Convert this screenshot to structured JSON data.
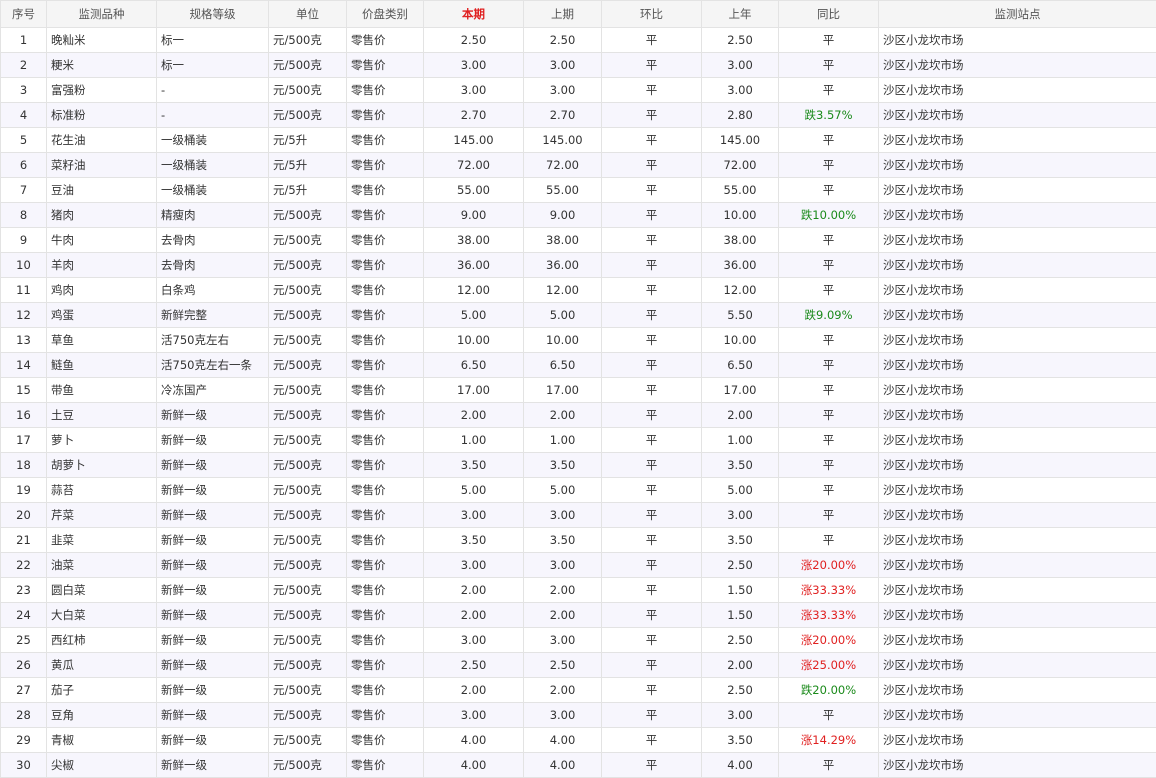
{
  "headers": {
    "seq": "序号",
    "item": "监测品种",
    "spec": "规格等级",
    "unit": "单位",
    "price_type": "价盘类别",
    "current": "本期",
    "previous": "上期",
    "mom": "环比",
    "last_year": "上年",
    "yoy": "同比",
    "station": "监测站点"
  },
  "colors": {
    "highlight": "#e02020",
    "rise": "#e02020",
    "fall": "#1a8a1a",
    "stripe": "#f7f6fd"
  },
  "rows": [
    {
      "seq": "1",
      "item": "晚籼米",
      "spec": "标一",
      "unit": "元/500克",
      "type": "零售价",
      "cur": "2.50",
      "prev": "2.50",
      "mom": "平",
      "ly": "2.50",
      "yoy": "平",
      "yoy_trend": "flat",
      "station": "沙区小龙坎市场"
    },
    {
      "seq": "2",
      "item": "粳米",
      "spec": "标一",
      "unit": "元/500克",
      "type": "零售价",
      "cur": "3.00",
      "prev": "3.00",
      "mom": "平",
      "ly": "3.00",
      "yoy": "平",
      "yoy_trend": "flat",
      "station": "沙区小龙坎市场"
    },
    {
      "seq": "3",
      "item": "富强粉",
      "spec": "-",
      "unit": "元/500克",
      "type": "零售价",
      "cur": "3.00",
      "prev": "3.00",
      "mom": "平",
      "ly": "3.00",
      "yoy": "平",
      "yoy_trend": "flat",
      "station": "沙区小龙坎市场"
    },
    {
      "seq": "4",
      "item": "标准粉",
      "spec": "-",
      "unit": "元/500克",
      "type": "零售价",
      "cur": "2.70",
      "prev": "2.70",
      "mom": "平",
      "ly": "2.80",
      "yoy": "跌3.57%",
      "yoy_trend": "down",
      "station": "沙区小龙坎市场"
    },
    {
      "seq": "5",
      "item": "花生油",
      "spec": "一级桶装",
      "unit": "元/5升",
      "type": "零售价",
      "cur": "145.00",
      "prev": "145.00",
      "mom": "平",
      "ly": "145.00",
      "yoy": "平",
      "yoy_trend": "flat",
      "station": "沙区小龙坎市场"
    },
    {
      "seq": "6",
      "item": "菜籽油",
      "spec": "一级桶装",
      "unit": "元/5升",
      "type": "零售价",
      "cur": "72.00",
      "prev": "72.00",
      "mom": "平",
      "ly": "72.00",
      "yoy": "平",
      "yoy_trend": "flat",
      "station": "沙区小龙坎市场"
    },
    {
      "seq": "7",
      "item": "豆油",
      "spec": "一级桶装",
      "unit": "元/5升",
      "type": "零售价",
      "cur": "55.00",
      "prev": "55.00",
      "mom": "平",
      "ly": "55.00",
      "yoy": "平",
      "yoy_trend": "flat",
      "station": "沙区小龙坎市场"
    },
    {
      "seq": "8",
      "item": "猪肉",
      "spec": "精瘦肉",
      "unit": "元/500克",
      "type": "零售价",
      "cur": "9.00",
      "prev": "9.00",
      "mom": "平",
      "ly": "10.00",
      "yoy": "跌10.00%",
      "yoy_trend": "down",
      "station": "沙区小龙坎市场"
    },
    {
      "seq": "9",
      "item": "牛肉",
      "spec": "去骨肉",
      "unit": "元/500克",
      "type": "零售价",
      "cur": "38.00",
      "prev": "38.00",
      "mom": "平",
      "ly": "38.00",
      "yoy": "平",
      "yoy_trend": "flat",
      "station": "沙区小龙坎市场"
    },
    {
      "seq": "10",
      "item": "羊肉",
      "spec": "去骨肉",
      "unit": "元/500克",
      "type": "零售价",
      "cur": "36.00",
      "prev": "36.00",
      "mom": "平",
      "ly": "36.00",
      "yoy": "平",
      "yoy_trend": "flat",
      "station": "沙区小龙坎市场"
    },
    {
      "seq": "11",
      "item": "鸡肉",
      "spec": "白条鸡",
      "unit": "元/500克",
      "type": "零售价",
      "cur": "12.00",
      "prev": "12.00",
      "mom": "平",
      "ly": "12.00",
      "yoy": "平",
      "yoy_trend": "flat",
      "station": "沙区小龙坎市场"
    },
    {
      "seq": "12",
      "item": "鸡蛋",
      "spec": "新鲜完整",
      "unit": "元/500克",
      "type": "零售价",
      "cur": "5.00",
      "prev": "5.00",
      "mom": "平",
      "ly": "5.50",
      "yoy": "跌9.09%",
      "yoy_trend": "down",
      "station": "沙区小龙坎市场"
    },
    {
      "seq": "13",
      "item": "草鱼",
      "spec": "活750克左右",
      "unit": "元/500克",
      "type": "零售价",
      "cur": "10.00",
      "prev": "10.00",
      "mom": "平",
      "ly": "10.00",
      "yoy": "平",
      "yoy_trend": "flat",
      "station": "沙区小龙坎市场"
    },
    {
      "seq": "14",
      "item": "鲢鱼",
      "spec": "活750克左右一条",
      "unit": "元/500克",
      "type": "零售价",
      "cur": "6.50",
      "prev": "6.50",
      "mom": "平",
      "ly": "6.50",
      "yoy": "平",
      "yoy_trend": "flat",
      "station": "沙区小龙坎市场"
    },
    {
      "seq": "15",
      "item": "带鱼",
      "spec": "冷冻国产",
      "unit": "元/500克",
      "type": "零售价",
      "cur": "17.00",
      "prev": "17.00",
      "mom": "平",
      "ly": "17.00",
      "yoy": "平",
      "yoy_trend": "flat",
      "station": "沙区小龙坎市场"
    },
    {
      "seq": "16",
      "item": "土豆",
      "spec": "新鲜一级",
      "unit": "元/500克",
      "type": "零售价",
      "cur": "2.00",
      "prev": "2.00",
      "mom": "平",
      "ly": "2.00",
      "yoy": "平",
      "yoy_trend": "flat",
      "station": "沙区小龙坎市场"
    },
    {
      "seq": "17",
      "item": "萝卜",
      "spec": "新鲜一级",
      "unit": "元/500克",
      "type": "零售价",
      "cur": "1.00",
      "prev": "1.00",
      "mom": "平",
      "ly": "1.00",
      "yoy": "平",
      "yoy_trend": "flat",
      "station": "沙区小龙坎市场"
    },
    {
      "seq": "18",
      "item": "胡萝卜",
      "spec": "新鲜一级",
      "unit": "元/500克",
      "type": "零售价",
      "cur": "3.50",
      "prev": "3.50",
      "mom": "平",
      "ly": "3.50",
      "yoy": "平",
      "yoy_trend": "flat",
      "station": "沙区小龙坎市场"
    },
    {
      "seq": "19",
      "item": "蒜苔",
      "spec": "新鲜一级",
      "unit": "元/500克",
      "type": "零售价",
      "cur": "5.00",
      "prev": "5.00",
      "mom": "平",
      "ly": "5.00",
      "yoy": "平",
      "yoy_trend": "flat",
      "station": "沙区小龙坎市场"
    },
    {
      "seq": "20",
      "item": "芹菜",
      "spec": "新鲜一级",
      "unit": "元/500克",
      "type": "零售价",
      "cur": "3.00",
      "prev": "3.00",
      "mom": "平",
      "ly": "3.00",
      "yoy": "平",
      "yoy_trend": "flat",
      "station": "沙区小龙坎市场"
    },
    {
      "seq": "21",
      "item": "韭菜",
      "spec": "新鲜一级",
      "unit": "元/500克",
      "type": "零售价",
      "cur": "3.50",
      "prev": "3.50",
      "mom": "平",
      "ly": "3.50",
      "yoy": "平",
      "yoy_trend": "flat",
      "station": "沙区小龙坎市场"
    },
    {
      "seq": "22",
      "item": "油菜",
      "spec": "新鲜一级",
      "unit": "元/500克",
      "type": "零售价",
      "cur": "3.00",
      "prev": "3.00",
      "mom": "平",
      "ly": "2.50",
      "yoy": "涨20.00%",
      "yoy_trend": "up",
      "station": "沙区小龙坎市场"
    },
    {
      "seq": "23",
      "item": "圆白菜",
      "spec": "新鲜一级",
      "unit": "元/500克",
      "type": "零售价",
      "cur": "2.00",
      "prev": "2.00",
      "mom": "平",
      "ly": "1.50",
      "yoy": "涨33.33%",
      "yoy_trend": "up",
      "station": "沙区小龙坎市场"
    },
    {
      "seq": "24",
      "item": "大白菜",
      "spec": "新鲜一级",
      "unit": "元/500克",
      "type": "零售价",
      "cur": "2.00",
      "prev": "2.00",
      "mom": "平",
      "ly": "1.50",
      "yoy": "涨33.33%",
      "yoy_trend": "up",
      "station": "沙区小龙坎市场"
    },
    {
      "seq": "25",
      "item": "西红柿",
      "spec": "新鲜一级",
      "unit": "元/500克",
      "type": "零售价",
      "cur": "3.00",
      "prev": "3.00",
      "mom": "平",
      "ly": "2.50",
      "yoy": "涨20.00%",
      "yoy_trend": "up",
      "station": "沙区小龙坎市场"
    },
    {
      "seq": "26",
      "item": "黄瓜",
      "spec": "新鲜一级",
      "unit": "元/500克",
      "type": "零售价",
      "cur": "2.50",
      "prev": "2.50",
      "mom": "平",
      "ly": "2.00",
      "yoy": "涨25.00%",
      "yoy_trend": "up",
      "station": "沙区小龙坎市场"
    },
    {
      "seq": "27",
      "item": "茄子",
      "spec": "新鲜一级",
      "unit": "元/500克",
      "type": "零售价",
      "cur": "2.00",
      "prev": "2.00",
      "mom": "平",
      "ly": "2.50",
      "yoy": "跌20.00%",
      "yoy_trend": "down",
      "station": "沙区小龙坎市场"
    },
    {
      "seq": "28",
      "item": "豆角",
      "spec": "新鲜一级",
      "unit": "元/500克",
      "type": "零售价",
      "cur": "3.00",
      "prev": "3.00",
      "mom": "平",
      "ly": "3.00",
      "yoy": "平",
      "yoy_trend": "flat",
      "station": "沙区小龙坎市场"
    },
    {
      "seq": "29",
      "item": "青椒",
      "spec": "新鲜一级",
      "unit": "元/500克",
      "type": "零售价",
      "cur": "4.00",
      "prev": "4.00",
      "mom": "平",
      "ly": "3.50",
      "yoy": "涨14.29%",
      "yoy_trend": "up",
      "station": "沙区小龙坎市场"
    },
    {
      "seq": "30",
      "item": "尖椒",
      "spec": "新鲜一级",
      "unit": "元/500克",
      "type": "零售价",
      "cur": "4.00",
      "prev": "4.00",
      "mom": "平",
      "ly": "4.00",
      "yoy": "平",
      "yoy_trend": "flat",
      "station": "沙区小龙坎市场"
    }
  ]
}
